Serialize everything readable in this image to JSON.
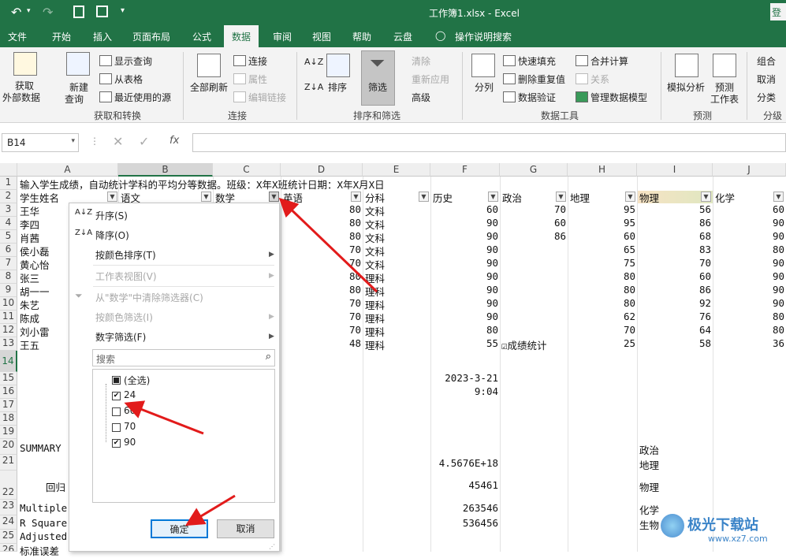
{
  "app": {
    "file_title": "工作簿1.xlsx - Excel",
    "login": "登"
  },
  "tabs": [
    "文件",
    "开始",
    "插入",
    "页面布局",
    "公式",
    "数据",
    "审阅",
    "视图",
    "帮助",
    "云盘",
    "操作说明搜索"
  ],
  "ribbon": {
    "get_data": [
      "获取",
      "外部数据"
    ],
    "new_query": [
      "新建",
      "查询"
    ],
    "show_query": "显示查询",
    "from_table": "从表格",
    "recent_sources": "最近使用的源",
    "group_transform": "获取和转换",
    "refresh_all": "全部刷新",
    "connections": "连接",
    "properties": "属性",
    "edit_links": "编辑链接",
    "group_connections": "连接",
    "sort": "排序",
    "filter": "筛选",
    "clear": "清除",
    "reapply": "重新应用",
    "advanced": "高级",
    "group_sort": "排序和筛选",
    "split": "分列",
    "flash_fill": "快速填充",
    "remove_dup": "删除重复值",
    "data_valid": "数据验证",
    "consolidate": "合并计算",
    "relations": "关系",
    "data_model": "管理数据模型",
    "group_tools": "数据工具",
    "whatif": "模拟分析",
    "forecast_sheet": [
      "预测",
      "工作表"
    ],
    "group_forecast": "预测",
    "outline1": "组合",
    "outline2": "取消",
    "outline3": "分类",
    "group_outline": "分级"
  },
  "namebox": "B14",
  "columns": [
    "A",
    "B",
    "C",
    "D",
    "E",
    "F",
    "G",
    "H",
    "I",
    "J"
  ],
  "rows": [
    "1",
    "2",
    "3",
    "4",
    "5",
    "6",
    "7",
    "8",
    "9",
    "10",
    "11",
    "12",
    "13",
    "14",
    "15",
    "16",
    "17",
    "18",
    "19",
    "20",
    "21",
    "22",
    "23",
    "24",
    "25",
    "26"
  ],
  "sheet": {
    "r1": "输入学生成绩，自动统计学科的平均分等数据。班级：X年X班统计日期：X年X月X日",
    "headers": [
      "学生姓名",
      "语文",
      "数学",
      "英语",
      "分科",
      "历史",
      "政治",
      "地理",
      "物理",
      "化学"
    ],
    "names": [
      "王华",
      "李四",
      "肖茜",
      "侯小磊",
      "黄心怡",
      "张三",
      "胡一一",
      "朱艺",
      "陈成",
      "刘小雷",
      "王五"
    ],
    "english": [
      "80",
      "80",
      "80",
      "70",
      "70",
      "80",
      "80",
      "70",
      "70",
      "70",
      "48"
    ],
    "branch": [
      "文科",
      "文科",
      "文科",
      "文科",
      "文科",
      "理科",
      "理科",
      "理科",
      "理科",
      "理科",
      "理科"
    ],
    "history": [
      "60",
      "90",
      "90",
      "90",
      "90",
      "90",
      "90",
      "90",
      "90",
      "80",
      "55"
    ],
    "politics": [
      "70",
      "60",
      "86",
      "",
      "",
      "",
      "",
      "",
      "",
      "",
      ""
    ],
    "r13_g": "☑成绩统计",
    "geo": [
      "95",
      "95",
      "60",
      "65",
      "75",
      "80",
      "80",
      "80",
      "62",
      "70",
      "25"
    ],
    "phys": [
      "56",
      "86",
      "68",
      "83",
      "70",
      "60",
      "86",
      "92",
      "76",
      "64",
      "58"
    ],
    "chem": [
      "60",
      "90",
      "90",
      "80",
      "90",
      "90",
      "90",
      "90",
      "80",
      "80",
      "36"
    ],
    "f15": "2023-3-21",
    "f16": "9:04",
    "a20": "SUMMARY",
    "i20": "政治",
    "f21": "4.5676E+18",
    "i21": "地理",
    "a22": "回归",
    "f22": "45461",
    "i22": "物理",
    "a23": "Multiple",
    "f23": "263546",
    "i23": "化学",
    "a24": "R Square",
    "f24": "536456",
    "i24": "生物",
    "a25": "Adjusted",
    "a26": "标准误差"
  },
  "filter_menu": {
    "sort_asc": "升序(S)",
    "sort_desc": "降序(O)",
    "sort_color": "按颜色排序(T)",
    "sheet_view": "工作表视图(V)",
    "clear_filter": "从\"数学\"中清除筛选器(C)",
    "filter_color": "按颜色筛选(I)",
    "number_filter": "数字筛选(F)",
    "search_placeholder": "搜索",
    "items": [
      {
        "label": "(全选)",
        "state": "partial"
      },
      {
        "label": "24",
        "state": "checked"
      },
      {
        "label": "60",
        "state": "unchecked"
      },
      {
        "label": "70",
        "state": "unchecked"
      },
      {
        "label": "90",
        "state": "checked"
      }
    ],
    "ok": "确定",
    "cancel": "取消"
  },
  "watermark": {
    "text": "极光下载站",
    "url": "www.xz7.com"
  },
  "colors": {
    "excel_green": "#217346",
    "annotation_red": "#e21b1b"
  }
}
